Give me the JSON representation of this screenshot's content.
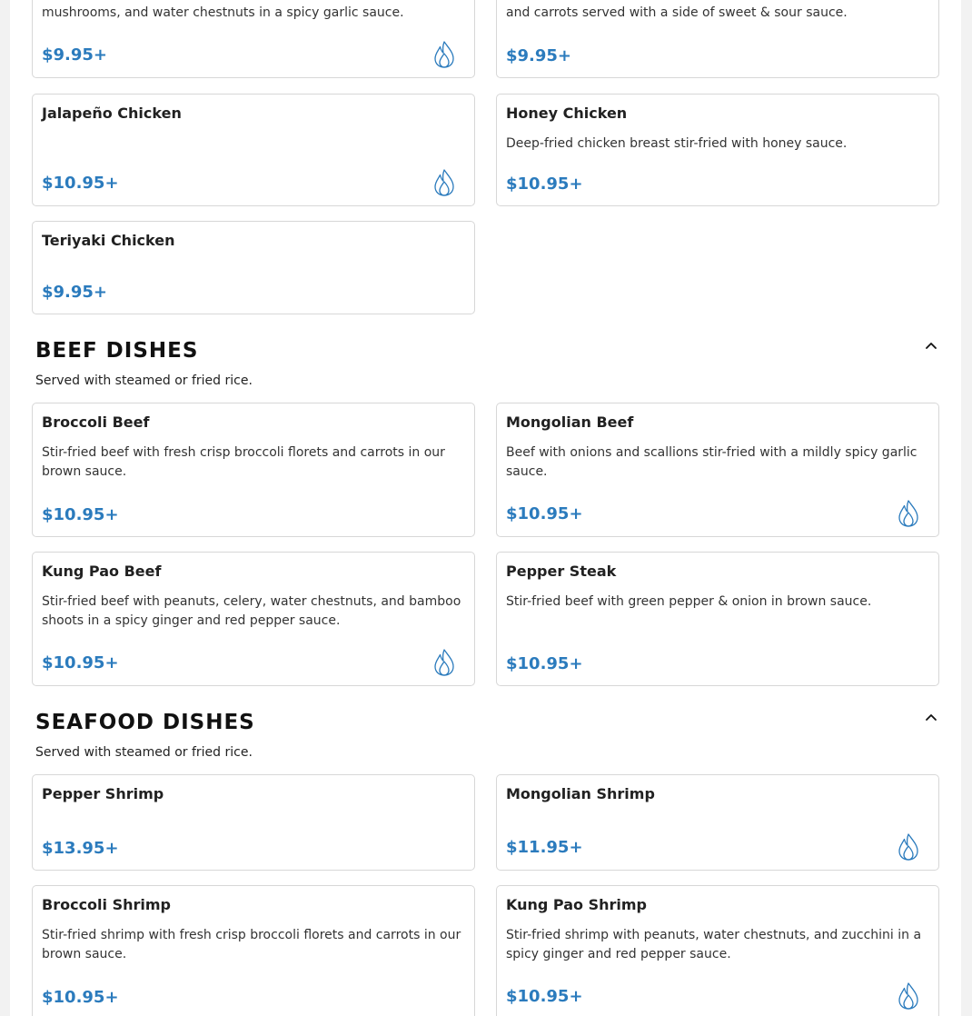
{
  "top_cards": [
    {
      "desc_line": "mushrooms, and water chestnuts in a spicy garlic sauce.",
      "price": "$9.95+",
      "spicy": true
    },
    {
      "desc_line": "and carrots served with a side of sweet & sour sauce.",
      "price": "$9.95+",
      "spicy": false
    }
  ],
  "chicken_items": [
    {
      "name": "Jalapeño Chicken",
      "desc": "",
      "price": "$10.95+",
      "spicy": true
    },
    {
      "name": "Honey Chicken",
      "desc": "Deep-fried chicken breast stir-fried with honey sauce.",
      "price": "$10.95+",
      "spicy": false
    },
    {
      "name": "Teriyaki Chicken",
      "desc": "",
      "price": "$9.95+",
      "spicy": false
    }
  ],
  "beef": {
    "title": "BEEF DISHES",
    "subtitle": "Served with steamed or fried rice.",
    "items": [
      {
        "name": "Broccoli Beef",
        "desc": "Stir-fried beef with fresh crisp broccoli florets and carrots in our brown sauce.",
        "price": "$10.95+",
        "spicy": false
      },
      {
        "name": "Mongolian Beef",
        "desc": "Beef with onions and scallions stir-fried with a mildly spicy garlic sauce.",
        "price": "$10.95+",
        "spicy": true
      },
      {
        "name": "Kung Pao Beef",
        "desc": "Stir-fried beef with peanuts, celery, water chestnuts, and bamboo shoots in a spicy ginger and red pepper sauce.",
        "price": "$10.95+",
        "spicy": true
      },
      {
        "name": "Pepper Steak",
        "desc": "Stir-fried beef with green pepper & onion in brown sauce.",
        "price": "$10.95+",
        "spicy": false
      }
    ]
  },
  "seafood": {
    "title": "SEAFOOD DISHES",
    "subtitle": "Served with steamed or fried rice.",
    "items": [
      {
        "name": "Pepper Shrimp",
        "desc": "",
        "price": "$13.95+",
        "spicy": false
      },
      {
        "name": "Mongolian Shrimp",
        "desc": "",
        "price": "$11.95+",
        "spicy": true
      },
      {
        "name": "Broccoli Shrimp",
        "desc": "Stir-fried shrimp with fresh crisp broccoli florets and carrots in our brown sauce.",
        "price": "$10.95+",
        "spicy": false
      },
      {
        "name": "Kung Pao Shrimp",
        "desc": "Stir-fried shrimp with peanuts, water chestnuts, and zucchini in a spicy ginger and red pepper sauce.",
        "price": "$10.95+",
        "spicy": true
      }
    ]
  },
  "icons": {
    "spicy": "flame-icon",
    "collapse": "chevron-up-icon"
  },
  "colors": {
    "price": "#2b7bbd",
    "spicy_icon": "#2b7bbd",
    "card_border": "#d7d7d7"
  }
}
